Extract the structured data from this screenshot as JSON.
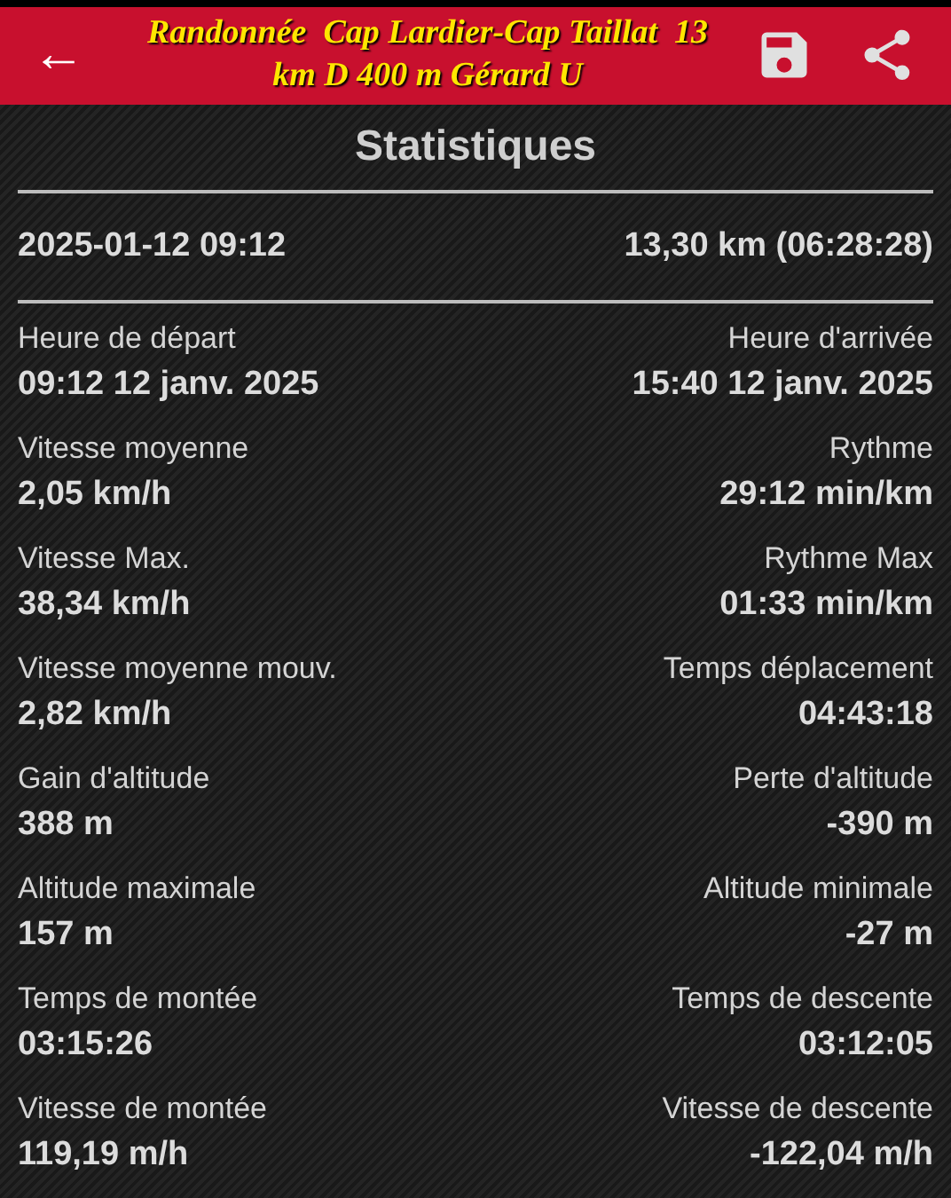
{
  "header": {
    "back": "←",
    "title": "Randonnée  Cap Lardier-Cap Taillat  13 km D 400 m Gérard U"
  },
  "heading": "Statistiques",
  "summary": {
    "date": "2025-01-12 09:12",
    "distance": "13,30 km (06:28:28)"
  },
  "stats": [
    {
      "left": {
        "label": "Heure de départ",
        "value": "09:12 12 janv. 2025"
      },
      "right": {
        "label": "Heure d'arrivée",
        "value": "15:40 12 janv. 2025"
      }
    },
    {
      "left": {
        "label": "Vitesse moyenne",
        "value": "2,05 km/h"
      },
      "right": {
        "label": "Rythme",
        "value": "29:12 min/km"
      }
    },
    {
      "left": {
        "label": "Vitesse Max.",
        "value": "38,34 km/h"
      },
      "right": {
        "label": "Rythme Max",
        "value": "01:33 min/km"
      }
    },
    {
      "left": {
        "label": "Vitesse moyenne mouv.",
        "value": "2,82 km/h"
      },
      "right": {
        "label": "Temps déplacement",
        "value": "04:43:18"
      }
    },
    {
      "left": {
        "label": "Gain d'altitude",
        "value": "388 m"
      },
      "right": {
        "label": "Perte d'altitude",
        "value": "-390 m"
      }
    },
    {
      "left": {
        "label": "Altitude maximale",
        "value": "157 m"
      },
      "right": {
        "label": "Altitude minimale",
        "value": "-27 m"
      }
    },
    {
      "left": {
        "label": "Temps de montée",
        "value": "03:15:26"
      },
      "right": {
        "label": "Temps de descente",
        "value": "03:12:05"
      }
    },
    {
      "left": {
        "label": "Vitesse de montée",
        "value": "119,19 m/h"
      },
      "right": {
        "label": "Vitesse de descente",
        "value": "-122,04 m/h"
      }
    }
  ]
}
